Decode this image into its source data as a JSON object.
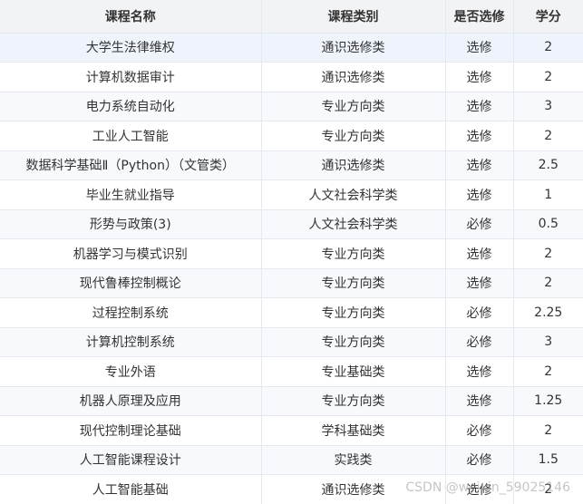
{
  "table": {
    "headers": {
      "name": "课程名称",
      "type": "课程类别",
      "selection": "是否选修",
      "credit": "学分"
    },
    "rows": [
      {
        "name": "大学生法律维权",
        "type": "通识选修类",
        "selection": "选修",
        "credit": "2"
      },
      {
        "name": "计算机数据审计",
        "type": "通识选修类",
        "selection": "选修",
        "credit": "2"
      },
      {
        "name": "电力系统自动化",
        "type": "专业方向类",
        "selection": "选修",
        "credit": "3"
      },
      {
        "name": "工业人工智能",
        "type": "专业方向类",
        "selection": "选修",
        "credit": "2"
      },
      {
        "name": "数据科学基础Ⅱ（Python）（文管类）",
        "type": "通识选修类",
        "selection": "选修",
        "credit": "2.5"
      },
      {
        "name": "毕业生就业指导",
        "type": "人文社会科学类",
        "selection": "选修",
        "credit": "1"
      },
      {
        "name": "形势与政策(3)",
        "type": "人文社会科学类",
        "selection": "必修",
        "credit": "0.5"
      },
      {
        "name": "机器学习与模式识别",
        "type": "专业方向类",
        "selection": "选修",
        "credit": "2"
      },
      {
        "name": "现代鲁棒控制概论",
        "type": "专业方向类",
        "selection": "选修",
        "credit": "2"
      },
      {
        "name": "过程控制系统",
        "type": "专业方向类",
        "selection": "必修",
        "credit": "2.25"
      },
      {
        "name": "计算机控制系统",
        "type": "专业方向类",
        "selection": "必修",
        "credit": "3"
      },
      {
        "name": "专业外语",
        "type": "专业基础类",
        "selection": "选修",
        "credit": "2"
      },
      {
        "name": "机器人原理及应用",
        "type": "专业方向类",
        "selection": "选修",
        "credit": "1.25"
      },
      {
        "name": "现代控制理论基础",
        "type": "学科基础类",
        "selection": "必修",
        "credit": "2"
      },
      {
        "name": "人工智能课程设计",
        "type": "实践类",
        "selection": "必修",
        "credit": "1.5"
      },
      {
        "name": "人工智能基础",
        "type": "通识选修类",
        "selection": "选修",
        "credit": "2"
      }
    ]
  },
  "watermark": "CSDN @weixin_59025146",
  "colors": {
    "header_bg": "#f2f3f5",
    "row_odd_bg": "#f7f9fc",
    "row_even_bg": "#ffffff",
    "selected_row_bg": "#eef3fc",
    "border": "#e4e8ef",
    "text": "#333333"
  }
}
